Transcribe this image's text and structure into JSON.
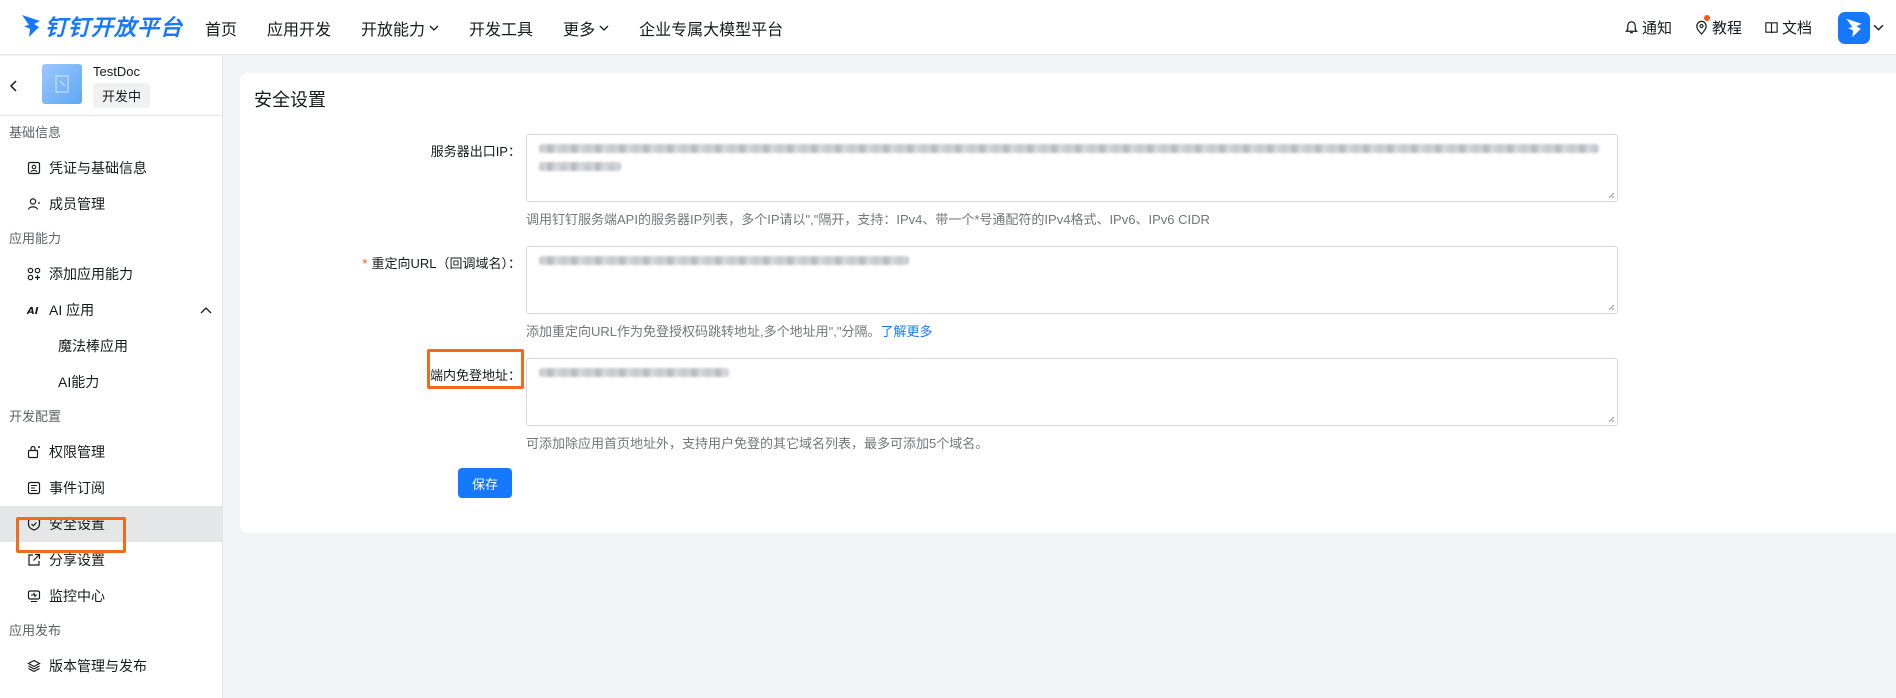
{
  "topbar": {
    "logo_text": "钉钉开放平台",
    "nav": [
      {
        "label": "首页"
      },
      {
        "label": "应用开发"
      },
      {
        "label": "开放能力",
        "has_dropdown": true
      },
      {
        "label": "开发工具"
      },
      {
        "label": "更多",
        "has_dropdown": true
      },
      {
        "label": "企业专属大模型平台"
      }
    ],
    "right": {
      "notify_label": "通知",
      "tutorial_label": "教程",
      "docs_label": "文档"
    }
  },
  "sidebar": {
    "app_name": "TestDoc",
    "app_status": "开发中",
    "sections": {
      "basic": "基础信息",
      "ability": "应用能力",
      "dev_config": "开发配置",
      "publish": "应用发布"
    },
    "items": {
      "credentials": "凭证与基础信息",
      "members": "成员管理",
      "add_ability": "添加应用能力",
      "ai_app": "AI 应用",
      "magic_wand": "魔法棒应用",
      "ai_ability": "AI能力",
      "permissions": "权限管理",
      "events": "事件订阅",
      "security": "安全设置",
      "share": "分享设置",
      "monitor": "监控中心",
      "versions": "版本管理与发布"
    },
    "active_item": "security"
  },
  "main": {
    "title": "安全设置",
    "fields": {
      "server_ip": {
        "label": "服务器出口IP",
        "hint": "调用钉钉服务端API的服务器IP列表，多个IP请以\",\"隔开，支持：IPv4、带一个*号通配符的IPv4格式、IPv6、IPv6 CIDR"
      },
      "redirect_url": {
        "label": "重定向URL（回调域名）",
        "required": true,
        "hint_text": "添加重定向URL作为免登授权码跳转地址,多个地址用\",\"分隔。",
        "hint_link": "了解更多"
      },
      "sso_domain": {
        "label": "端内免登地址",
        "hint": "可添加除应用首页地址外，支持用户免登的其它域名列表，最多可添加5个域名。"
      }
    },
    "save_label": "保存"
  },
  "colors": {
    "accent": "#1677ff",
    "highlight": "#f26a1b",
    "required": "#ff5219"
  }
}
